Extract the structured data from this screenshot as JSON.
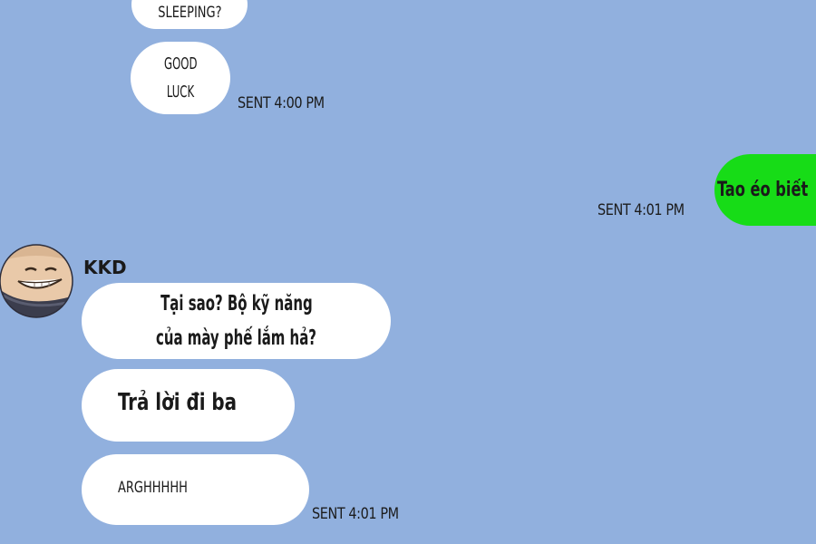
{
  "chat": {
    "messages_top": [
      {
        "text": "SLEEPING?"
      },
      {
        "text_line1": "GOOD",
        "text_line2": "LUCK"
      }
    ],
    "sent_top": "SENT 4:00 PM",
    "my_message": "Tao éo biết",
    "sent_mine": "SENT 4:01 PM",
    "sender_name": "KKD",
    "avatar_icon": "cartoon-face-icon",
    "messages_kkd": [
      {
        "line1": "Tại sao? Bộ kỹ năng",
        "line2": "của mày phế lắm hả?"
      },
      {
        "text": "Trả lời đi ba"
      },
      {
        "text": "ARGHHHHH"
      }
    ],
    "sent_bottom": "SENT 4:01 PM"
  },
  "colors": {
    "background": "#91b0de",
    "incoming_bubble": "#ffffff",
    "outgoing_bubble": "#17dc17"
  }
}
